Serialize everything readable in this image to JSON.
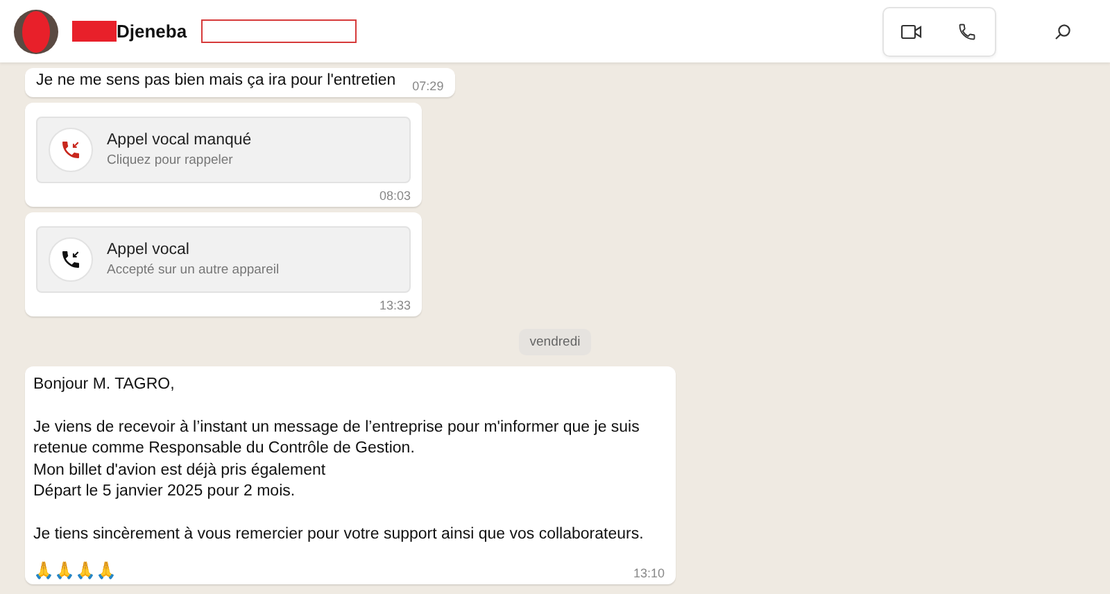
{
  "header": {
    "contact_name": "Djeneba"
  },
  "messages": [
    {
      "kind": "text",
      "text": "Je ne me sens pas bien mais ça ira pour l'entretien",
      "time": "07:29"
    },
    {
      "kind": "call",
      "missed": true,
      "title": "Appel vocal manqué",
      "subtitle": "Cliquez pour rappeler",
      "time": "08:03"
    },
    {
      "kind": "call",
      "missed": false,
      "title": "Appel vocal",
      "subtitle": "Accepté sur un autre appareil",
      "time": "13:33"
    },
    {
      "kind": "date",
      "text": "vendredi"
    },
    {
      "kind": "long",
      "text": "Bonjour M. TAGRO,\n\nJe viens de recevoir à l’instant un message de l’entreprise pour m'informer que je suis retenue comme Responsable du Contrôle de Gestion.\nMon billet d'avion est déjà pris également\nDépart le 5 janvier 2025 pour 2 mois.\n\nJe tiens sincèrement à vous remercier pour votre support ainsi que vos collaborateurs.",
      "emoji": "🙏🙏🙏🙏",
      "time": "13:10"
    }
  ]
}
